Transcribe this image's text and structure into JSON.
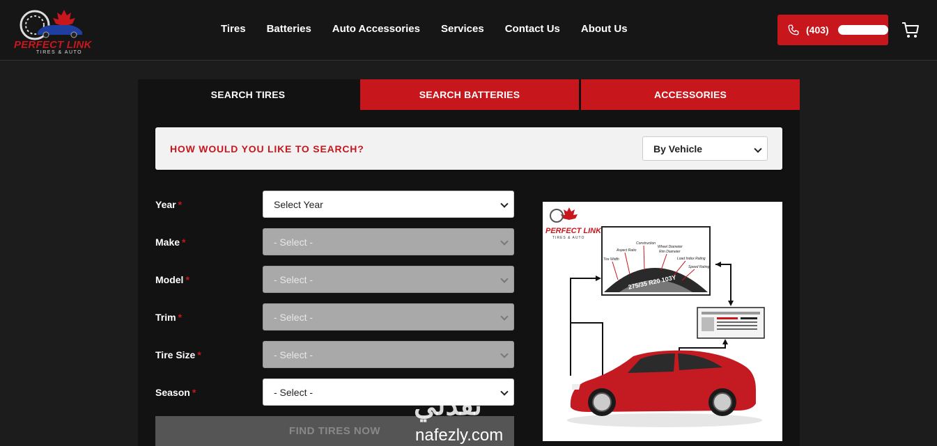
{
  "header": {
    "logo": {
      "brand": "PERFECT LINK",
      "sub": "TIRES & AUTO"
    },
    "nav": [
      "Tires",
      "Batteries",
      "Auto Accessories",
      "Services",
      "Contact Us",
      "About Us"
    ],
    "phone": "(403)",
    "icons": {
      "phone": "phone-icon",
      "cart": "cart-icon"
    }
  },
  "tabs": [
    "SEARCH TIRES",
    "SEARCH BATTERIES",
    "ACCESSORIES"
  ],
  "search_mode": {
    "question": "HOW WOULD YOU LIKE TO SEARCH?",
    "selected": "By Vehicle"
  },
  "form": {
    "year": {
      "label": "Year",
      "value": "Select Year"
    },
    "make": {
      "label": "Make",
      "value": "- Select -"
    },
    "model": {
      "label": "Model",
      "value": "- Select -"
    },
    "trim": {
      "label": "Trim",
      "value": "- Select -"
    },
    "tire_size": {
      "label": "Tire Size",
      "value": "- Select -"
    },
    "season": {
      "label": "Season",
      "value": "- Select -"
    },
    "required_mark": "*",
    "submit": "FIND TIRES NOW"
  },
  "diagram": {
    "brand": "PERFECT LINK",
    "sub": "TIRES & AUTO",
    "tire_code": "275/35 R20 103Y",
    "labels": [
      "Tire Width",
      "Aspect Ratio",
      "Construction",
      "Wheel Diameter",
      "Rim Diameter",
      "Load Index Rating",
      "Speed Rating"
    ]
  },
  "watermark": {
    "arabic": "نفذلي",
    "latin": "nafezly.com"
  },
  "colors": {
    "accent": "#c8161d",
    "background": "#1c1c1c",
    "panel": "#121212"
  }
}
